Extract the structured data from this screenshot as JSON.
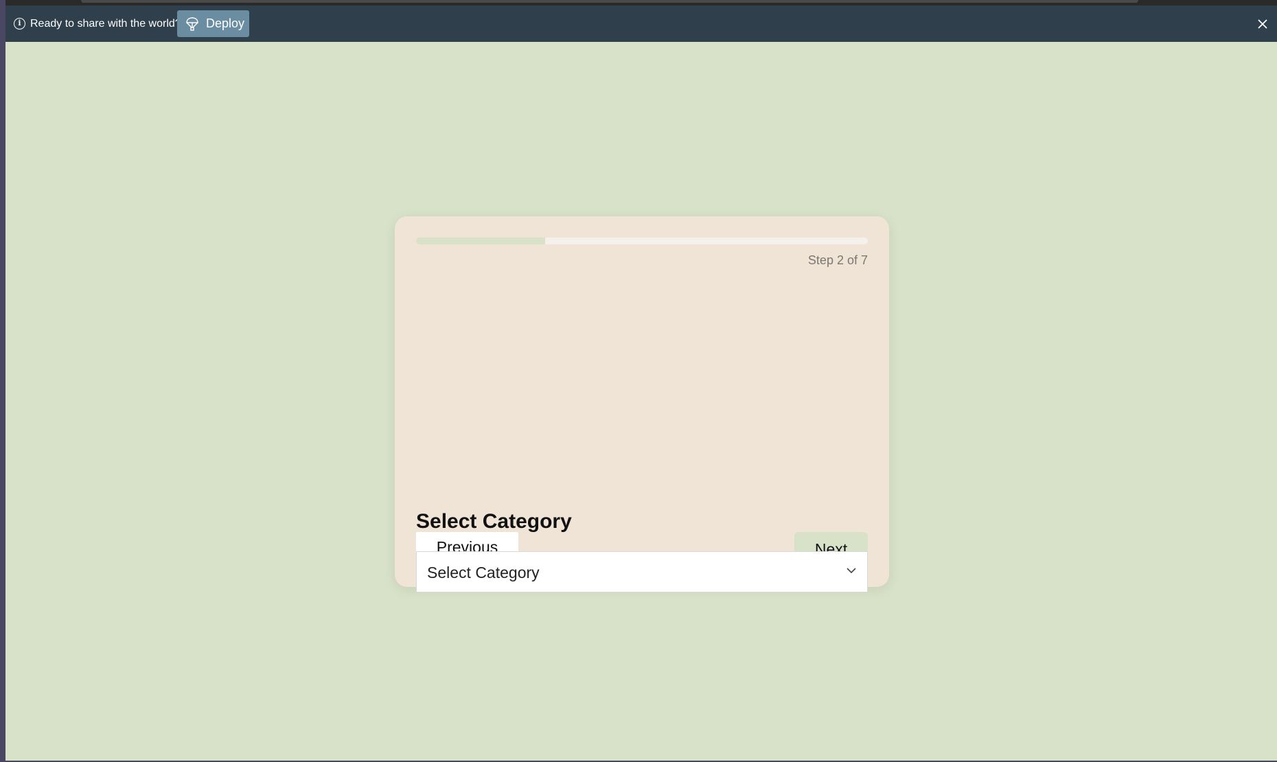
{
  "deploy_banner": {
    "message": "Ready to share with the world?",
    "button_label": "Deploy"
  },
  "wizard": {
    "progress": 0.2857,
    "step_label": "Step 2 of 7",
    "title": "Select Category",
    "previous_label": "Previous",
    "next_label": "Next",
    "category_select": {
      "value": "Select Category"
    }
  },
  "colors": {
    "page_background": "#d8e2c8",
    "card_background": "#efe4d6",
    "banner_background": "#2f3f4b",
    "deploy_button": "#6b8da1",
    "progress_fill": "#d8e2c8",
    "progress_track": "#f5f1ea"
  }
}
